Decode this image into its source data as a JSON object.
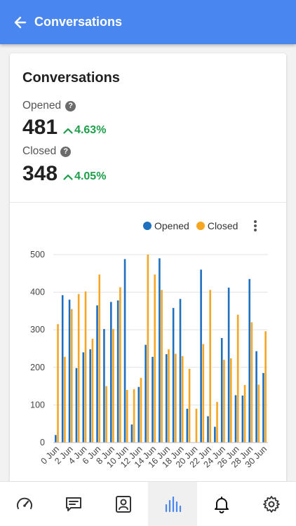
{
  "appbar": {
    "title": "Conversations"
  },
  "card": {
    "title": "Conversations",
    "opened": {
      "label": "Opened",
      "value": "481",
      "change": "4.63%"
    },
    "closed": {
      "label": "Closed",
      "value": "348",
      "change": "4.05%"
    }
  },
  "legend": {
    "opened": "Opened",
    "closed": "Closed"
  },
  "colors": {
    "opened": "#1f6fbf",
    "closed": "#f5a623",
    "positive": "#1e9e4a",
    "appbar": "#4a86f0",
    "active_nav": "#4a86f0"
  },
  "nav": {
    "items": [
      {
        "icon": "speedometer-icon",
        "active": false
      },
      {
        "icon": "message-icon",
        "active": false
      },
      {
        "icon": "contact-icon",
        "active": false
      },
      {
        "icon": "bar-chart-icon",
        "active": true
      },
      {
        "icon": "bell-icon",
        "active": false
      },
      {
        "icon": "gear-icon",
        "active": false
      }
    ]
  },
  "chart_data": {
    "type": "bar",
    "categories": [
      "0 Jun",
      "1 Jun",
      "2 Jun",
      "3 Jun",
      "4 Jun",
      "5 Jun",
      "6 Jun",
      "7 Jun",
      "8 Jun",
      "9 Jun",
      "10 Jun",
      "11 Jun",
      "12 Jun",
      "13 Jun",
      "14 Jun",
      "15 Jun",
      "16 Jun",
      "17 Jun",
      "18 Jun",
      "19 Jun",
      "20 Jun",
      "21 Jun",
      "22 Jun",
      "23 Jun",
      "24 Jun",
      "25 Jun",
      "26 Jun",
      "27 Jun",
      "28 Jun",
      "29 Jun",
      "30 Jun"
    ],
    "tick_labels": [
      "0 Jun",
      "2 Jun",
      "4 Jun",
      "6 Jun",
      "8 Jun",
      "10 Jun",
      "12 Jun",
      "14 Jun",
      "16 Jun",
      "18 Jun",
      "20 Jun",
      "22 Jun",
      "24 Jun",
      "26 Jun",
      "28 Jun",
      "30 Jun"
    ],
    "series": [
      {
        "name": "Opened",
        "values": [
          20,
          392,
          380,
          198,
          240,
          248,
          365,
          302,
          374,
          378,
          488,
          48,
          148,
          260,
          228,
          490,
          235,
          358,
          382,
          90,
          0,
          460,
          70,
          42,
          278,
          412,
          126,
          125,
          435,
          243,
          185
        ]
      },
      {
        "name": "Closed",
        "values": [
          315,
          228,
          355,
          395,
          402,
          276,
          447,
          150,
          302,
          413,
          140,
          142,
          172,
          500,
          447,
          406,
          248,
          236,
          230,
          196,
          90,
          262,
          406,
          108,
          220,
          224,
          340,
          153,
          320,
          154,
          296
        ]
      }
    ],
    "ylim": [
      0,
      500
    ],
    "yticks": [
      0,
      100,
      200,
      300,
      400,
      500
    ],
    "grid": true,
    "legend_position": "top-right"
  }
}
